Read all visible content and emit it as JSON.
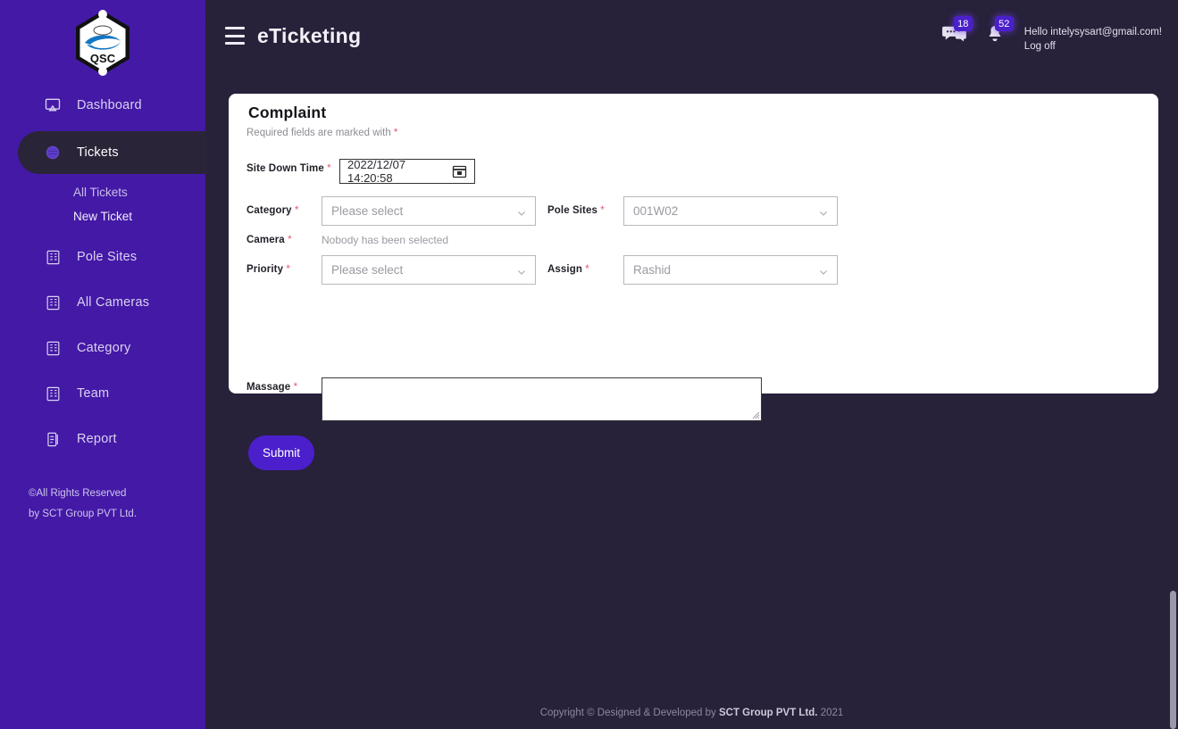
{
  "brand": {
    "logo_text": "QSC",
    "accent_purple": "#4B1FCB",
    "sidebar_purple": "#4419A6",
    "main_dark": "#272139",
    "required_star_color": "#E8566E"
  },
  "sidebar": {
    "items": [
      {
        "label": "Dashboard",
        "icon": "monitor-icon",
        "active": false
      },
      {
        "label": "Tickets",
        "icon": "ticket-icon",
        "active": true
      },
      {
        "label": "Pole Sites",
        "icon": "list-card-icon",
        "active": false
      },
      {
        "label": "All Cameras",
        "icon": "list-card-icon",
        "active": false
      },
      {
        "label": "Category",
        "icon": "list-card-icon",
        "active": false
      },
      {
        "label": "Team",
        "icon": "list-card-icon",
        "active": false
      },
      {
        "label": "Report",
        "icon": "clipboard-icon",
        "active": false
      }
    ],
    "subnav": [
      {
        "label": "All Tickets",
        "current": false
      },
      {
        "label": "New Ticket",
        "current": true
      }
    ],
    "copyright_line1": "©All Rights Reserved",
    "copyright_line2": "by SCT Group PVT Ltd."
  },
  "header": {
    "menu_icon": "hamburger-icon",
    "title": "eTicketing",
    "messages": {
      "icon": "chat-bubble-icon",
      "count": "18"
    },
    "notifications": {
      "icon": "bell-icon",
      "count": "52"
    },
    "greeting": "Hello intelysysart@gmail.com!",
    "logoff": "Log off"
  },
  "card": {
    "title": "Complaint",
    "required_note_text": "Required fields are marked with",
    "required_star": "*",
    "fields": {
      "site_down_time": {
        "label": "Site Down Time",
        "star": "*",
        "value": "2022/12/07 14:20:58",
        "icon": "calendar-icon"
      },
      "category": {
        "label": "Category",
        "star": "*",
        "value": "Please select",
        "icon": "chevron-down-icon"
      },
      "pole_sites": {
        "label": "Pole Sites",
        "star": "*",
        "value": "001W02",
        "icon": "chevron-down-icon"
      },
      "camera": {
        "label": "Camera",
        "star": "*",
        "hint": "Nobody has been selected"
      },
      "priority": {
        "label": "Priority",
        "star": "*",
        "value": "Please select",
        "icon": "chevron-down-icon"
      },
      "assign": {
        "label": "Assign",
        "star": "*",
        "value": "Rashid",
        "icon": "chevron-down-icon"
      },
      "massage": {
        "label": "Massage",
        "star": "*",
        "value": "",
        "placeholder": ""
      }
    },
    "submit_label": "Submit"
  },
  "footer": {
    "prefix": "Copyright © Designed & Developed by",
    "company": "SCT Group PVT Ltd.",
    "year": "2021"
  }
}
